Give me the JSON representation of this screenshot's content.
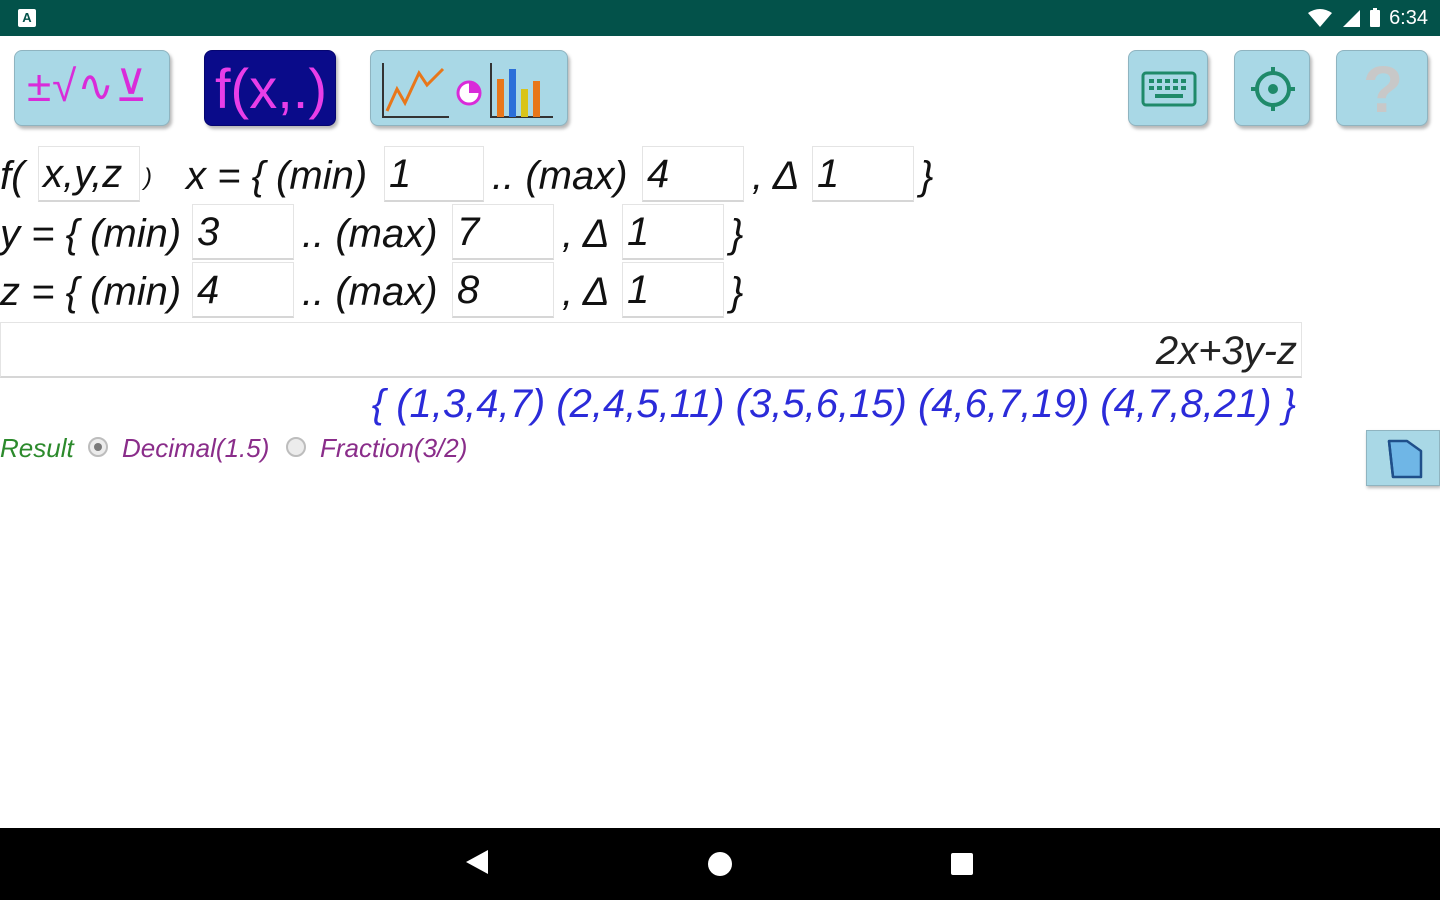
{
  "status_bar": {
    "time": "6:34",
    "left_icon": "A",
    "icons": [
      "wifi-icon",
      "signal-icon",
      "battery-icon"
    ]
  },
  "toolbar": {
    "calculator_label": "±√∿⊻",
    "function_label": "f(x,.)",
    "graph_icons": [
      "line-chart-icon",
      "pie-chart-icon",
      "bar-chart-icon"
    ],
    "keyboard_icon": "keyboard-icon",
    "settings_icon": "gear-icon",
    "help_label": "?"
  },
  "function": {
    "prefix": "f(",
    "args": "x,y,z",
    "close": ")",
    "x_label": "x = { (min)",
    "y_label": "y = { (min)",
    "z_label": "z = { (min)",
    "max_label": ".. (max)",
    "delta_label": ", Δ",
    "brace_close": "}",
    "x": {
      "min": "1",
      "max": "4",
      "delta": "1"
    },
    "y": {
      "min": "3",
      "max": "7",
      "delta": "1"
    },
    "z": {
      "min": "4",
      "max": "8",
      "delta": "1"
    }
  },
  "expression": "2x+3y-z",
  "result": "{ (1,3,4,7) (2,4,5,11) (3,5,6,15) (4,6,7,19) (4,7,8,21) }",
  "result_format": {
    "label": "Result",
    "options": [
      {
        "label": "Decimal(1.5)",
        "selected": true
      },
      {
        "label": "Fraction(3/2)",
        "selected": false
      }
    ]
  },
  "colors": {
    "status_bar": "#03524a",
    "button_bg": "#a9d8e6",
    "active_button_bg": "#0a0b8a",
    "accent_magenta": "#e83ee8",
    "result_blue": "#2b2bd9",
    "result_label_green": "#2c8a2c",
    "radio_label_purple": "#8a2d8a"
  }
}
